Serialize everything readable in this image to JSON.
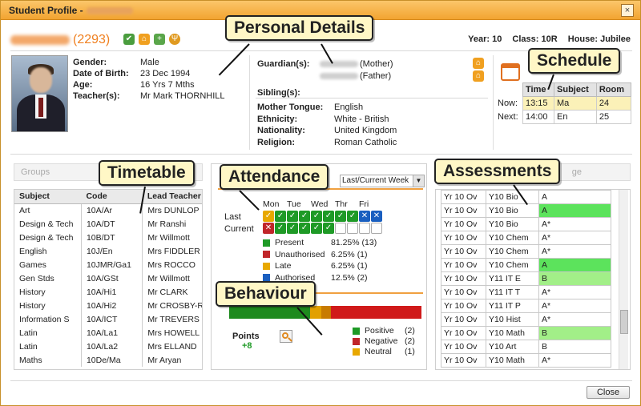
{
  "window": {
    "title": "Student Profile -",
    "close_icon": "×"
  },
  "student": {
    "id": "(2293)",
    "year": "Year: 10",
    "class": "Class: 10R",
    "house": "House: Jubilee"
  },
  "details": {
    "gender_label": "Gender:",
    "gender": "Male",
    "dob_label": "Date of Birth:",
    "dob": "23 Dec 1994",
    "age_label": "Age:",
    "age": "16 Yrs 7 Mths",
    "teacher_label": "Teacher(s):",
    "teacher": "Mr Mark THORNHILL"
  },
  "family": {
    "guardian_label": "Guardian(s):",
    "guardian1": "(Mother)",
    "guardian2": "(Father)",
    "sibling_label": "Sibling(s):"
  },
  "background": {
    "tongue_label": "Mother Tongue:",
    "tongue": "English",
    "ethnicity_label": "Ethnicity:",
    "ethnicity": "White - British",
    "nationality_label": "Nationality:",
    "nationality": "United Kingdom",
    "religion_label": "Religion:",
    "religion": "Roman Catholic"
  },
  "schedule": {
    "headers": [
      "Time",
      "Subject",
      "Room"
    ],
    "now_label": "Now:",
    "next_label": "Next:",
    "now": [
      "13:15",
      "Ma",
      "24"
    ],
    "next": [
      "14:00",
      "En",
      "25"
    ]
  },
  "annotations": {
    "personal": "Personal Details",
    "schedule": "Schedule",
    "timetable": "Timetable",
    "attendance": "Attendance",
    "assessments": "Assessments",
    "behaviour": "Behaviour"
  },
  "groups": {
    "header_placeholder": "Groups",
    "columns": [
      "Subject",
      "Code",
      "Lead Teacher"
    ],
    "rows": [
      [
        "Art",
        "10A/Ar",
        "Mrs DUNLOP"
      ],
      [
        "Design & Tech",
        "10A/DT",
        "Mr Ranshi"
      ],
      [
        "Design & Tech",
        "10B/DT",
        "Mr Willmott"
      ],
      [
        "English",
        "10J/En",
        "Mrs FIDDLER"
      ],
      [
        "Games",
        "10JMR/Ga1",
        "Mrs ROCCO"
      ],
      [
        "Gen Stds",
        "10A/GSt",
        "Mr Willmott"
      ],
      [
        "History",
        "10A/Hi1",
        "Mr CLARK"
      ],
      [
        "History",
        "10A/Hi2",
        "Mr CROSBY-R"
      ],
      [
        "Information S",
        "10A/ICT",
        "Mr TREVERS"
      ],
      [
        "Latin",
        "10A/La1",
        "Mrs HOWELL"
      ],
      [
        "Latin",
        "10A/La2",
        "Mrs ELLAND"
      ],
      [
        "Maths",
        "10De/Ma",
        "Mr Aryan"
      ]
    ]
  },
  "attendance": {
    "period_select": "Last/Current Week",
    "days": [
      "Mon",
      "Tue",
      "Wed",
      "Thr",
      "Fri"
    ],
    "last_label": "Last",
    "current_label": "Current",
    "last_marks": [
      "y",
      "g",
      "g",
      "g",
      "g",
      "g",
      "g",
      "g",
      "b",
      "b"
    ],
    "current_marks": [
      "r",
      "g",
      "g",
      "g",
      "g",
      "g",
      "e",
      "e",
      "e",
      "e"
    ],
    "legend": [
      {
        "label": "Present",
        "value": "81.25% (13)",
        "color": "#1e9a26"
      },
      {
        "label": "Unauthorised",
        "value": "6.25% (1)",
        "color": "#c0262a"
      },
      {
        "label": "Late",
        "value": "6.25% (1)",
        "color": "#e8a800"
      },
      {
        "label": "Authorised",
        "value": "12.5% (2)",
        "color": "#1a5fc0"
      }
    ]
  },
  "behaviour": {
    "points_label": "Points",
    "points": "+8",
    "segments": [
      {
        "share": 0.42,
        "color": "#1e8a1e"
      },
      {
        "share": 0.06,
        "color": "#e2a000"
      },
      {
        "share": 0.05,
        "color": "#c87b00"
      },
      {
        "share": 0.47,
        "color": "#d01a1a"
      }
    ],
    "legend": [
      {
        "label": "Positive",
        "value": "(2)",
        "color": "#1e9a26"
      },
      {
        "label": "Negative",
        "value": "(2)",
        "color": "#c0262a"
      },
      {
        "label": "Neutral",
        "value": "(1)",
        "color": "#e8a800"
      }
    ]
  },
  "assessments": {
    "header_placeholder": "ge",
    "rows": [
      [
        "Yr 10 Ov",
        "Y10 Bio",
        "A",
        "none"
      ],
      [
        "Yr 10 Ov",
        "Y10 Bio",
        "A",
        "green"
      ],
      [
        "Yr 10 Ov",
        "Y10 Bio",
        "A*",
        "none"
      ],
      [
        "Yr 10 Ov",
        "Y10 Chem",
        "A*",
        "none"
      ],
      [
        "Yr 10 Ov",
        "Y10 Chem",
        "A*",
        "none"
      ],
      [
        "Yr 10 Ov",
        "Y10 Chem",
        "A",
        "green"
      ],
      [
        "Yr 10 Ov",
        "Y11 IT E",
        "B",
        "lightgreen"
      ],
      [
        "Yr 10 Ov",
        "Y11 IT T",
        "A*",
        "none"
      ],
      [
        "Yr 10 Ov",
        "Y11 IT P",
        "A*",
        "none"
      ],
      [
        "Yr 10 Ov",
        "Y10 Hist",
        "A*",
        "none"
      ],
      [
        "Yr 10 Ov",
        "Y10 Math",
        "B",
        "lightgreen"
      ],
      [
        "Yr 10 Ov",
        "Y10 Art",
        "B",
        "none"
      ],
      [
        "Yr 10 Ov",
        "Y10 Math",
        "A*",
        "none"
      ]
    ]
  },
  "footer": {
    "close_label": "Close"
  }
}
